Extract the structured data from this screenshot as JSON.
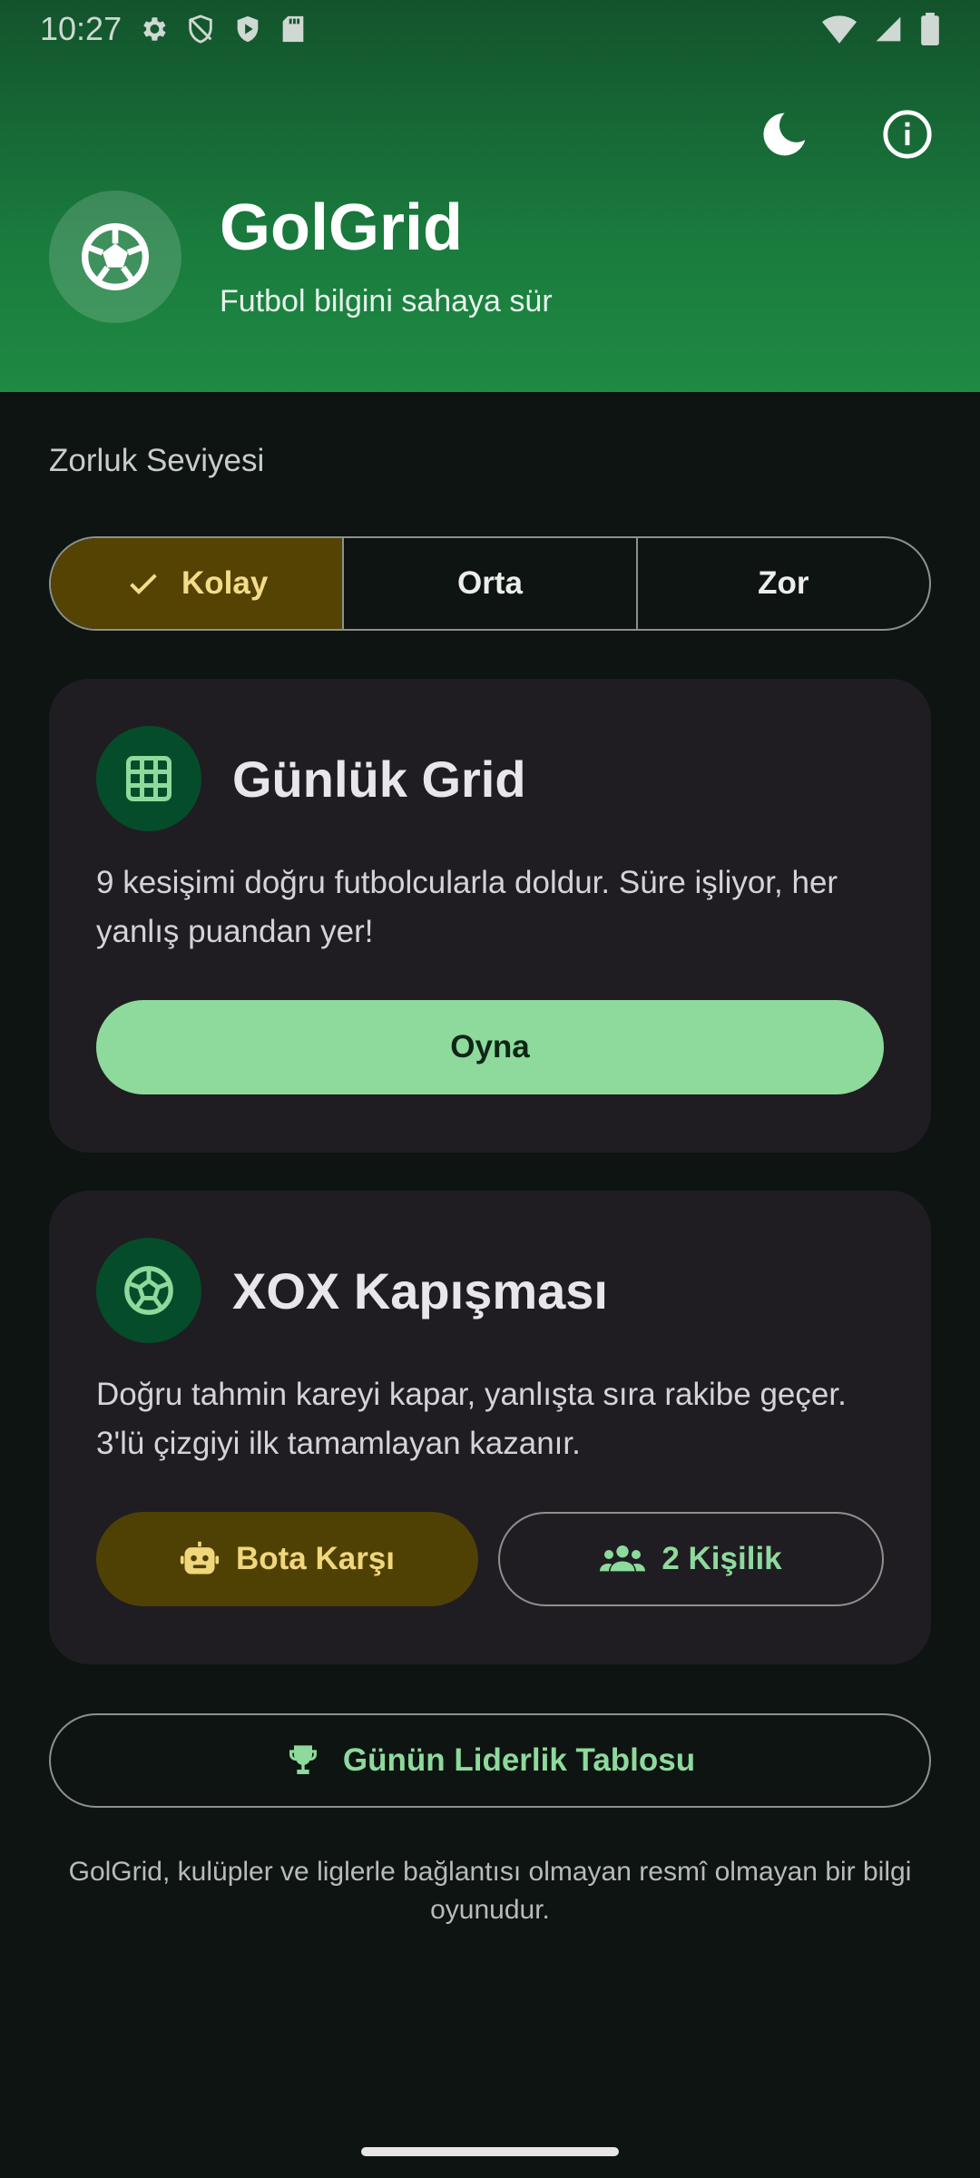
{
  "status_bar": {
    "time": "10:27"
  },
  "header": {
    "title": "GolGrid",
    "subtitle": "Futbol bilgini sahaya sür",
    "icons": [
      "moon-icon",
      "info-icon",
      "soccer-ball-icon"
    ]
  },
  "difficulty": {
    "label": "Zorluk Seviyesi",
    "options": [
      {
        "label": "Kolay",
        "selected": true
      },
      {
        "label": "Orta",
        "selected": false
      },
      {
        "label": "Zor",
        "selected": false
      }
    ]
  },
  "daily_grid": {
    "title": "Günlük Grid",
    "description": "9 kesişimi doğru futbolcularla doldur. Süre işliyor, her yanlış puandan yer!",
    "play_label": "Oyna"
  },
  "xox": {
    "title": "XOX Kapışması",
    "description": "Doğru tahmin kareyi kapar, yanlışta sıra rakibe geçer. 3'lü çizgiyi ilk tamamlayan kazanır.",
    "bot_label": "Bota Karşı",
    "two_player_label": "2 Kişilik"
  },
  "leaderboard": {
    "label": "Günün Liderlik Tablosu"
  },
  "disclaimer": "GolGrid, kulüpler ve liglerle bağlantısı olmayan resmî olmayan bir bilgi oyunudur.",
  "colors": {
    "primary": "#8dda9c",
    "selected_bg": "#544303",
    "selected_text": "#f3dd8a",
    "card_bg": "#1f1d22",
    "header_green": "#1e8a43"
  }
}
